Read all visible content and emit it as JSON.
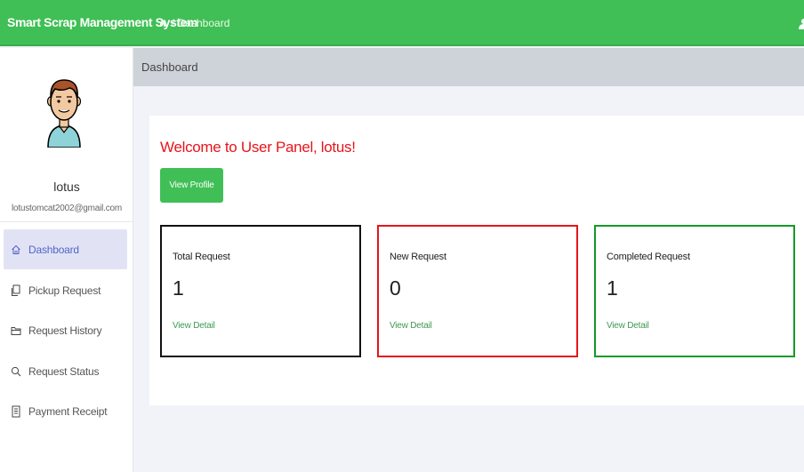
{
  "header": {
    "brand": "Smart Scrap Management System",
    "breadcrumb": "/ Dashboard"
  },
  "sidebar": {
    "username": "lotus",
    "email": "lotustomcat2002@gmail.com",
    "items": [
      {
        "label": "Dashboard",
        "icon": "home-icon",
        "active": true
      },
      {
        "label": "Pickup Request",
        "icon": "files-icon"
      },
      {
        "label": "Request History",
        "icon": "folder-icon"
      },
      {
        "label": "Request Status",
        "icon": "search-icon"
      },
      {
        "label": "Payment Receipt",
        "icon": "receipt-icon"
      }
    ]
  },
  "page": {
    "title": "Dashboard",
    "welcome": "Welcome to User Panel, lotus!",
    "view_profile_label": "View Profile"
  },
  "stats": [
    {
      "label": "Total Request",
      "value": "1",
      "link": "View Detail",
      "color": "#111111"
    },
    {
      "label": "New Request",
      "value": "0",
      "link": "View Detail",
      "color": "#e4161c"
    },
    {
      "label": "Completed Request",
      "value": "1",
      "link": "View Detail",
      "color": "#139a25"
    }
  ],
  "colors": {
    "brand_green": "#3fbf55",
    "welcome_red": "#e8141c",
    "link_green": "#3e9a53",
    "active_nav": "#5563c8"
  }
}
